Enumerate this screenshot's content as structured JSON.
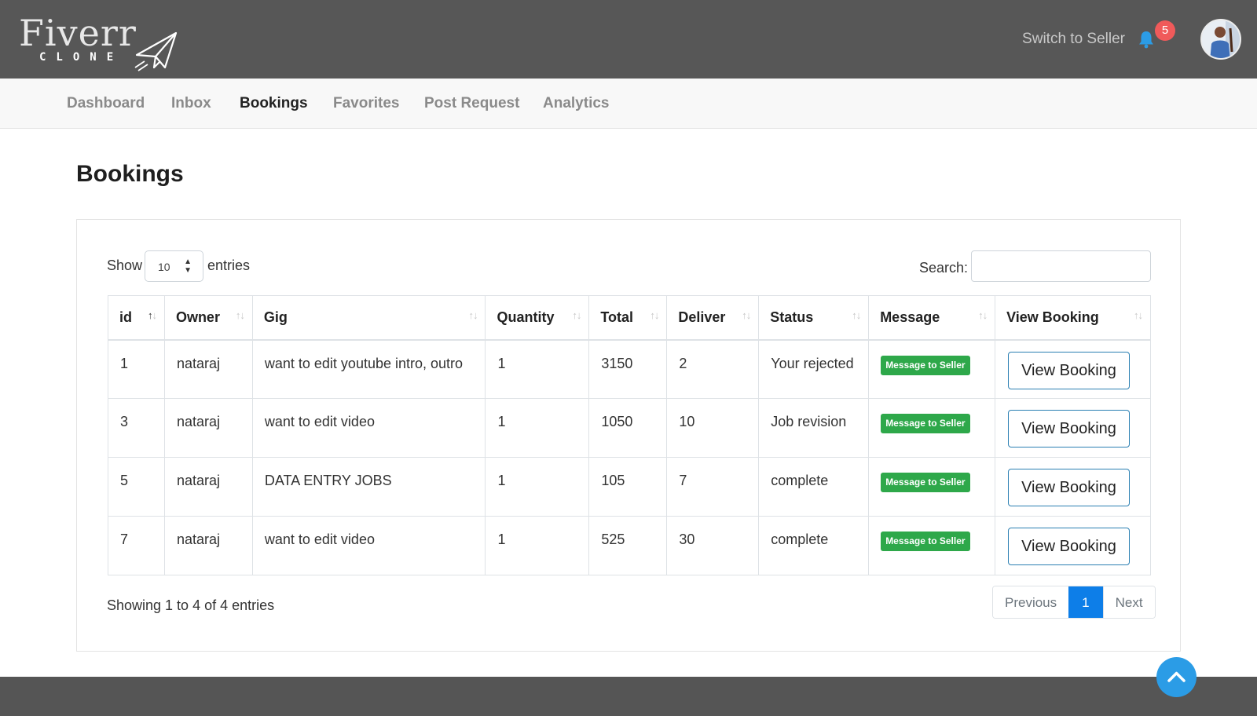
{
  "brand": {
    "name": "Fiverr",
    "tagline": "CLONE"
  },
  "header": {
    "switch_label": "Switch to Seller",
    "notification_count": "5",
    "accent": "#2b9ce6",
    "badge_color": "#f05a5a"
  },
  "nav": {
    "items": [
      {
        "label": "Dashboard"
      },
      {
        "label": "Inbox"
      },
      {
        "label": "Bookings"
      },
      {
        "label": "Favorites"
      },
      {
        "label": "Post Request"
      },
      {
        "label": "Analytics"
      }
    ],
    "active": "Bookings"
  },
  "page": {
    "title": "Bookings"
  },
  "controls": {
    "show_label": "Show",
    "page_length": "10",
    "entries_label": "entries",
    "search_label": "Search:",
    "search_value": ""
  },
  "table": {
    "columns": [
      "id",
      "Owner",
      "Gig",
      "Quantity",
      "Total",
      "Deliver",
      "Status",
      "Message",
      "View Booking"
    ],
    "sorted_column": "id",
    "sort_direction": "ascending",
    "message_button_label": "Message to Seller",
    "message_button_color": "#2ea84a",
    "view_button_label": "View Booking",
    "rows": [
      {
        "id": "1",
        "owner": "nataraj",
        "gig": "want to edit youtube intro, outro",
        "quantity": "1",
        "total": "3150",
        "deliver": "2",
        "status": "Your rejected"
      },
      {
        "id": "3",
        "owner": "nataraj",
        "gig": "want to edit video",
        "quantity": "1",
        "total": "1050",
        "deliver": "10",
        "status": "Job revision"
      },
      {
        "id": "5",
        "owner": "nataraj",
        "gig": "DATA ENTRY JOBS",
        "quantity": "1",
        "total": "105",
        "deliver": "7",
        "status": "complete"
      },
      {
        "id": "7",
        "owner": "nataraj",
        "gig": "want to edit video",
        "quantity": "1",
        "total": "525",
        "deliver": "30",
        "status": "complete"
      }
    ]
  },
  "footer_info": {
    "text": "Showing 1 to 4 of 4 entries"
  },
  "pagination": {
    "previous": "Previous",
    "current": "1",
    "next": "Next"
  }
}
